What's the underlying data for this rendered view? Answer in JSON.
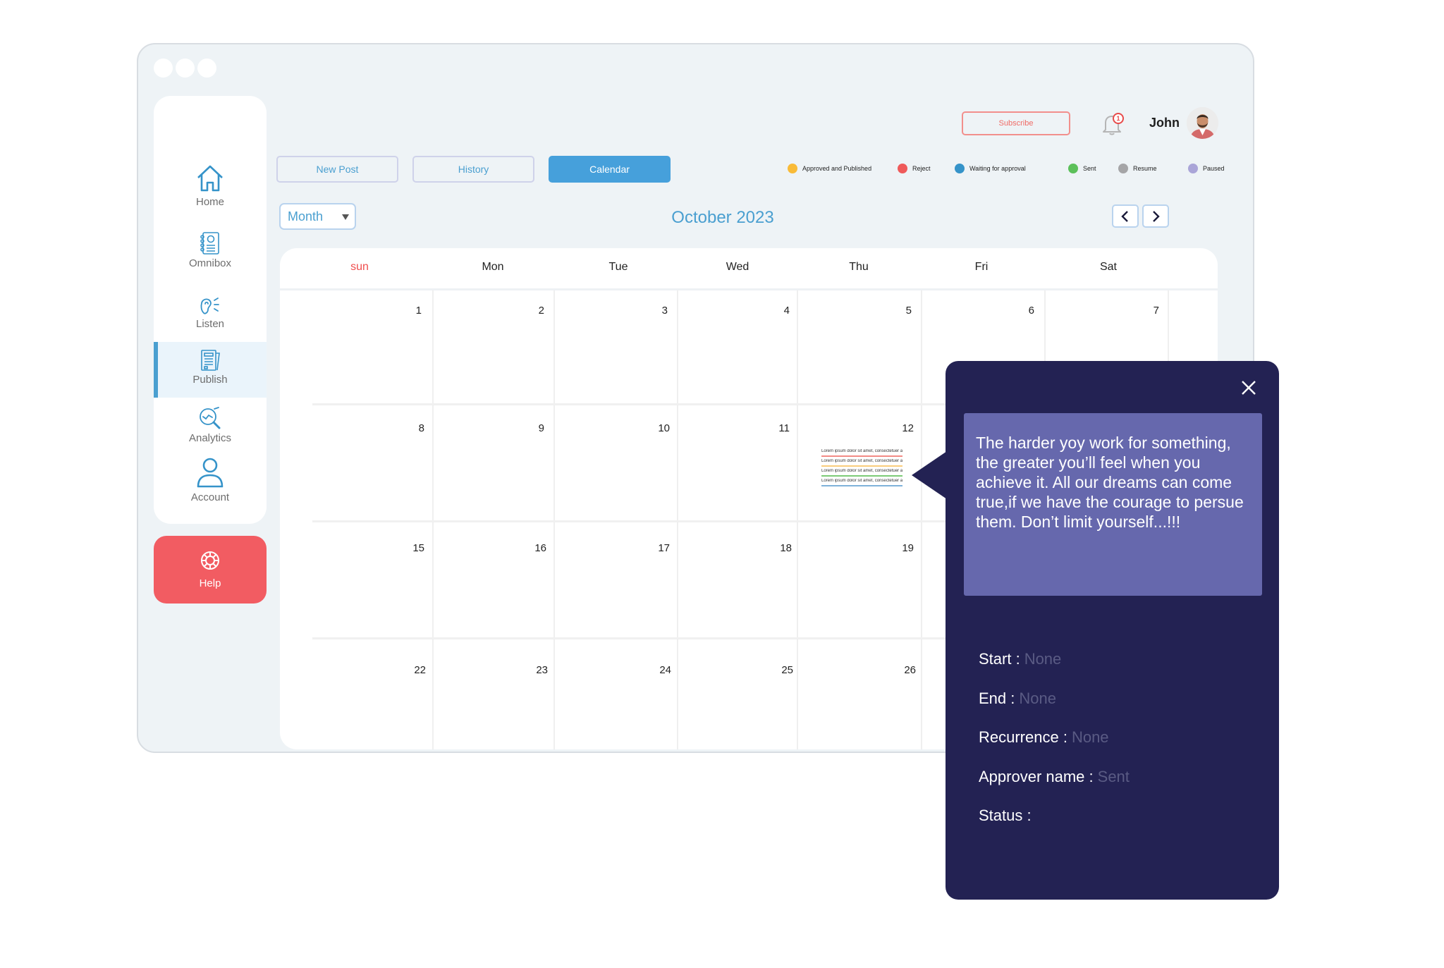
{
  "window": {
    "dots": 3
  },
  "sidebar": {
    "items": [
      {
        "label": "Home",
        "icon": "home-icon",
        "active": false
      },
      {
        "label": "Omnibox",
        "icon": "contact-book-icon",
        "active": false
      },
      {
        "label": "Listen",
        "icon": "ear-icon",
        "active": false
      },
      {
        "label": "Publish",
        "icon": "newspaper-icon",
        "active": true
      },
      {
        "label": "Analytics",
        "icon": "analytics-magnifier-icon",
        "active": false
      },
      {
        "label": "Account",
        "icon": "user-icon",
        "active": false
      }
    ],
    "help": {
      "label": "Help",
      "icon": "lifebuoy-icon"
    }
  },
  "header": {
    "subscribe_label": "Subscribe",
    "notification_count": "1",
    "user_name": "John"
  },
  "tabs": [
    {
      "label": "New Post",
      "active": false
    },
    {
      "label": "History",
      "active": false
    },
    {
      "label": "Calendar",
      "active": true
    }
  ],
  "legend": [
    {
      "label": "Approved and Published",
      "color": "#f9bb38"
    },
    {
      "label": "Reject",
      "color": "#ef5a5a"
    },
    {
      "label": "Waiting for approval",
      "color": "#3593c9"
    },
    {
      "label": "Sent",
      "color": "#5cc05a"
    },
    {
      "label": "Resume",
      "color": "#a5a5a7"
    },
    {
      "label": "Paused",
      "color": "#aaa5d8"
    }
  ],
  "calendar": {
    "view_select": "Month",
    "title": "October 2023",
    "prev_label": "<",
    "next_label": ">",
    "weekdays": [
      "sun",
      "Mon",
      "Tue",
      "Wed",
      "Thu",
      "Fri",
      "Sat"
    ],
    "weeks": [
      [
        "1",
        "2",
        "3",
        "4",
        "5",
        "6",
        "7"
      ],
      [
        "8",
        "9",
        "10",
        "11",
        "12",
        "",
        ""
      ],
      [
        "15",
        "16",
        "17",
        "18",
        "19",
        "",
        ""
      ],
      [
        "22",
        "23",
        "24",
        "25",
        "26",
        "",
        ""
      ]
    ],
    "events_day": "12",
    "events": [
      {
        "text": "Lorem ipsum dolor sit amet, consectetuer adipiscing elit, sed",
        "color": "#f28b86"
      },
      {
        "text": "Lorem ipsum dolor sit amet, consectetuer adipiscing elit, sed",
        "color": "#f9cc7c"
      },
      {
        "text": "Lorem ipsum dolor sit amet, consectetuer adipiscing elit, sed",
        "color": "#7ccb76"
      },
      {
        "text": "Lorem ipsum dolor sit amet, consectetuer adipiscing elit, sed",
        "color": "#7fb2d9"
      }
    ]
  },
  "popup": {
    "quote": "The harder yoy work for something, the greater you’ll feel when you achieve it. All our dreams can come true,if we have the courage to persue them. Don’t limit yourself...!!!",
    "fields": [
      {
        "label": "Start :",
        "value": "None"
      },
      {
        "label": "End :",
        "value": "None"
      },
      {
        "label": "Recurrence :",
        "value": "None"
      },
      {
        "label": "Approver name :",
        "value": "Sent"
      },
      {
        "label": "Status :",
        "value": ""
      }
    ]
  }
}
